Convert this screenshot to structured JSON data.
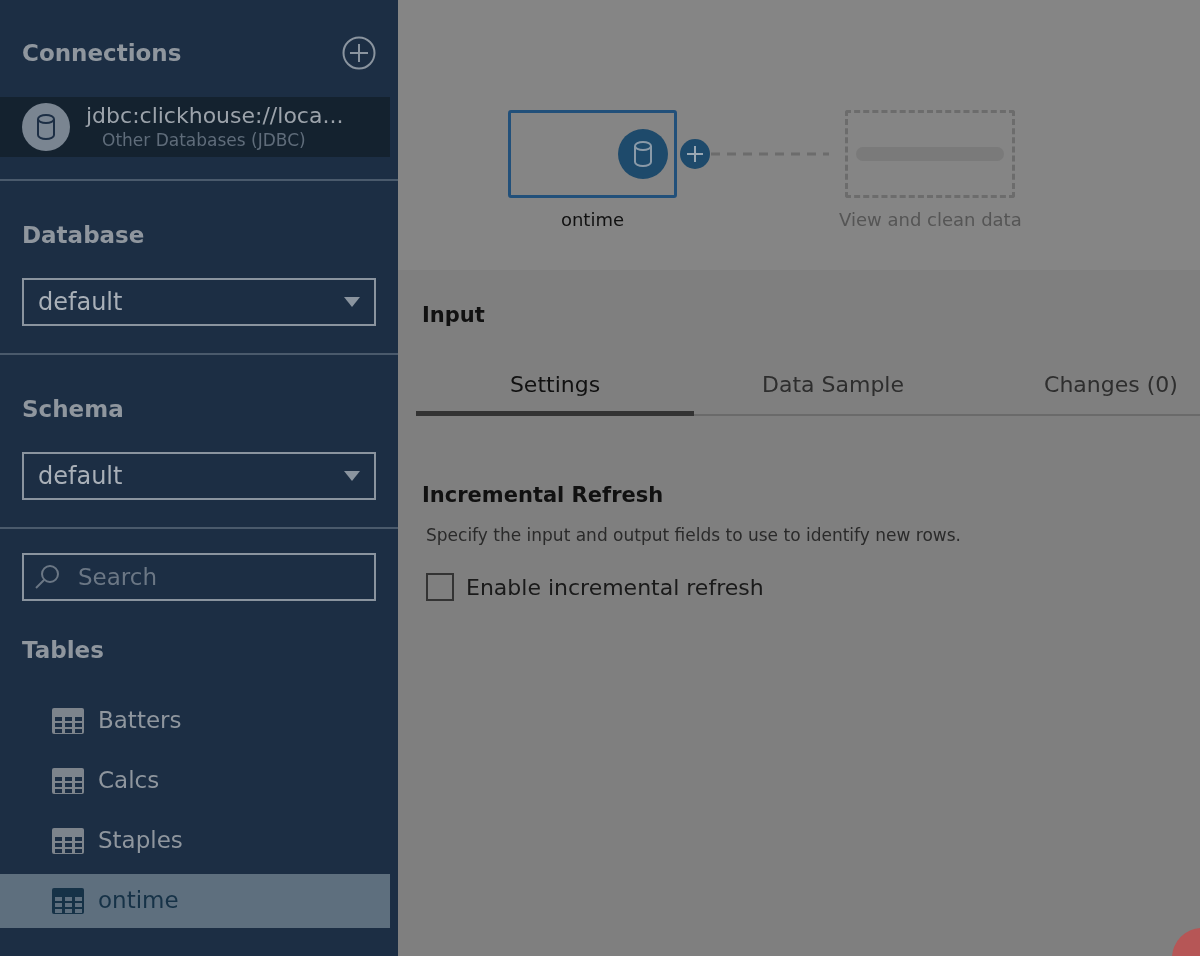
{
  "connections": {
    "title": "Connections",
    "item": {
      "name": "jdbc:clickhouse://loca...",
      "subtitle": "Other Databases (JDBC)",
      "selected": true
    }
  },
  "database": {
    "label": "Database",
    "value": "default"
  },
  "schema": {
    "label": "Schema",
    "value": "default"
  },
  "search": {
    "placeholder": "Search"
  },
  "tables": {
    "label": "Tables",
    "items": [
      {
        "name": "Batters",
        "selected": false
      },
      {
        "name": "Calcs",
        "selected": false
      },
      {
        "name": "Staples",
        "selected": false
      },
      {
        "name": "ontime",
        "selected": true
      }
    ]
  },
  "flow": {
    "nodes": [
      {
        "kind": "input",
        "label": "ontime",
        "selected": true
      },
      {
        "kind": "placeholder",
        "label": "View and clean data"
      }
    ]
  },
  "panel": {
    "title": "Input",
    "tabs": [
      {
        "label": "Settings",
        "selected": true
      },
      {
        "label": "Data Sample",
        "selected": false
      },
      {
        "label": "Changes (0)",
        "selected": false
      }
    ],
    "section": {
      "title": "Incremental Refresh",
      "description": "Specify the input and output fields to use to identify new rows."
    },
    "checkbox": {
      "label": "Enable incremental refresh",
      "checked": false
    }
  }
}
